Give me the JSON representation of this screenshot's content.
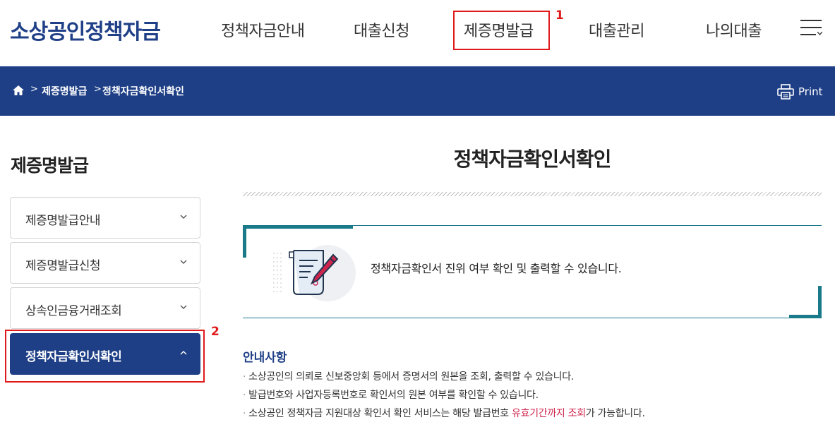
{
  "header": {
    "logo": "소상공인정책자금",
    "nav": [
      "정책자금안내",
      "대출신청",
      "제증명발급",
      "대출관리",
      "나의대출"
    ],
    "menu_icon": "hamburger-menu-icon"
  },
  "annotations": {
    "marker1": "1",
    "marker2": "2",
    "color": "#e0191b"
  },
  "breadcrumb": {
    "home_icon": "home-icon",
    "items": [
      "제증명발급",
      "정책자금확인서확인"
    ],
    "separator": ">"
  },
  "print": {
    "label": "Print",
    "icon": "printer-icon"
  },
  "sidebar": {
    "title": "제증명발급",
    "items": [
      {
        "label": "제증명발급안내",
        "icon": "chevron-down-icon"
      },
      {
        "label": "제증명발급신청",
        "icon": "chevron-down-icon"
      },
      {
        "label": "상속인금융거래조회",
        "icon": "chevron-down-icon"
      },
      {
        "label": "정책자금확인서확인",
        "icon": "chevron-up-icon"
      }
    ]
  },
  "main": {
    "title": "정책자금확인서확인",
    "info_text": "정책자금확인서 진위 여부 확인 및 출력할 수 있습니다.",
    "notice_title": "안내사항",
    "notices": [
      {
        "text": "소상공인의 의뢰로 신보중앙회 등에서 증명서의 원본을 조회, 출력할 수 있습니다."
      },
      {
        "text": "발급번호와 사업자등록번호로 확인서의 원본 여부를 확인할 수 있습니다."
      },
      {
        "pre": "소상공인 정책자금 지원대상 확인서 확인 서비스는 해당 발급번호 ",
        "em": "유효기간까지 조회",
        "post": "가 가능합니다."
      }
    ],
    "bullet": "·"
  },
  "colors": {
    "brand_navy": "#1e3f86",
    "accent_teal": "#1b7a8a",
    "emphasis_red": "#d0254d"
  }
}
